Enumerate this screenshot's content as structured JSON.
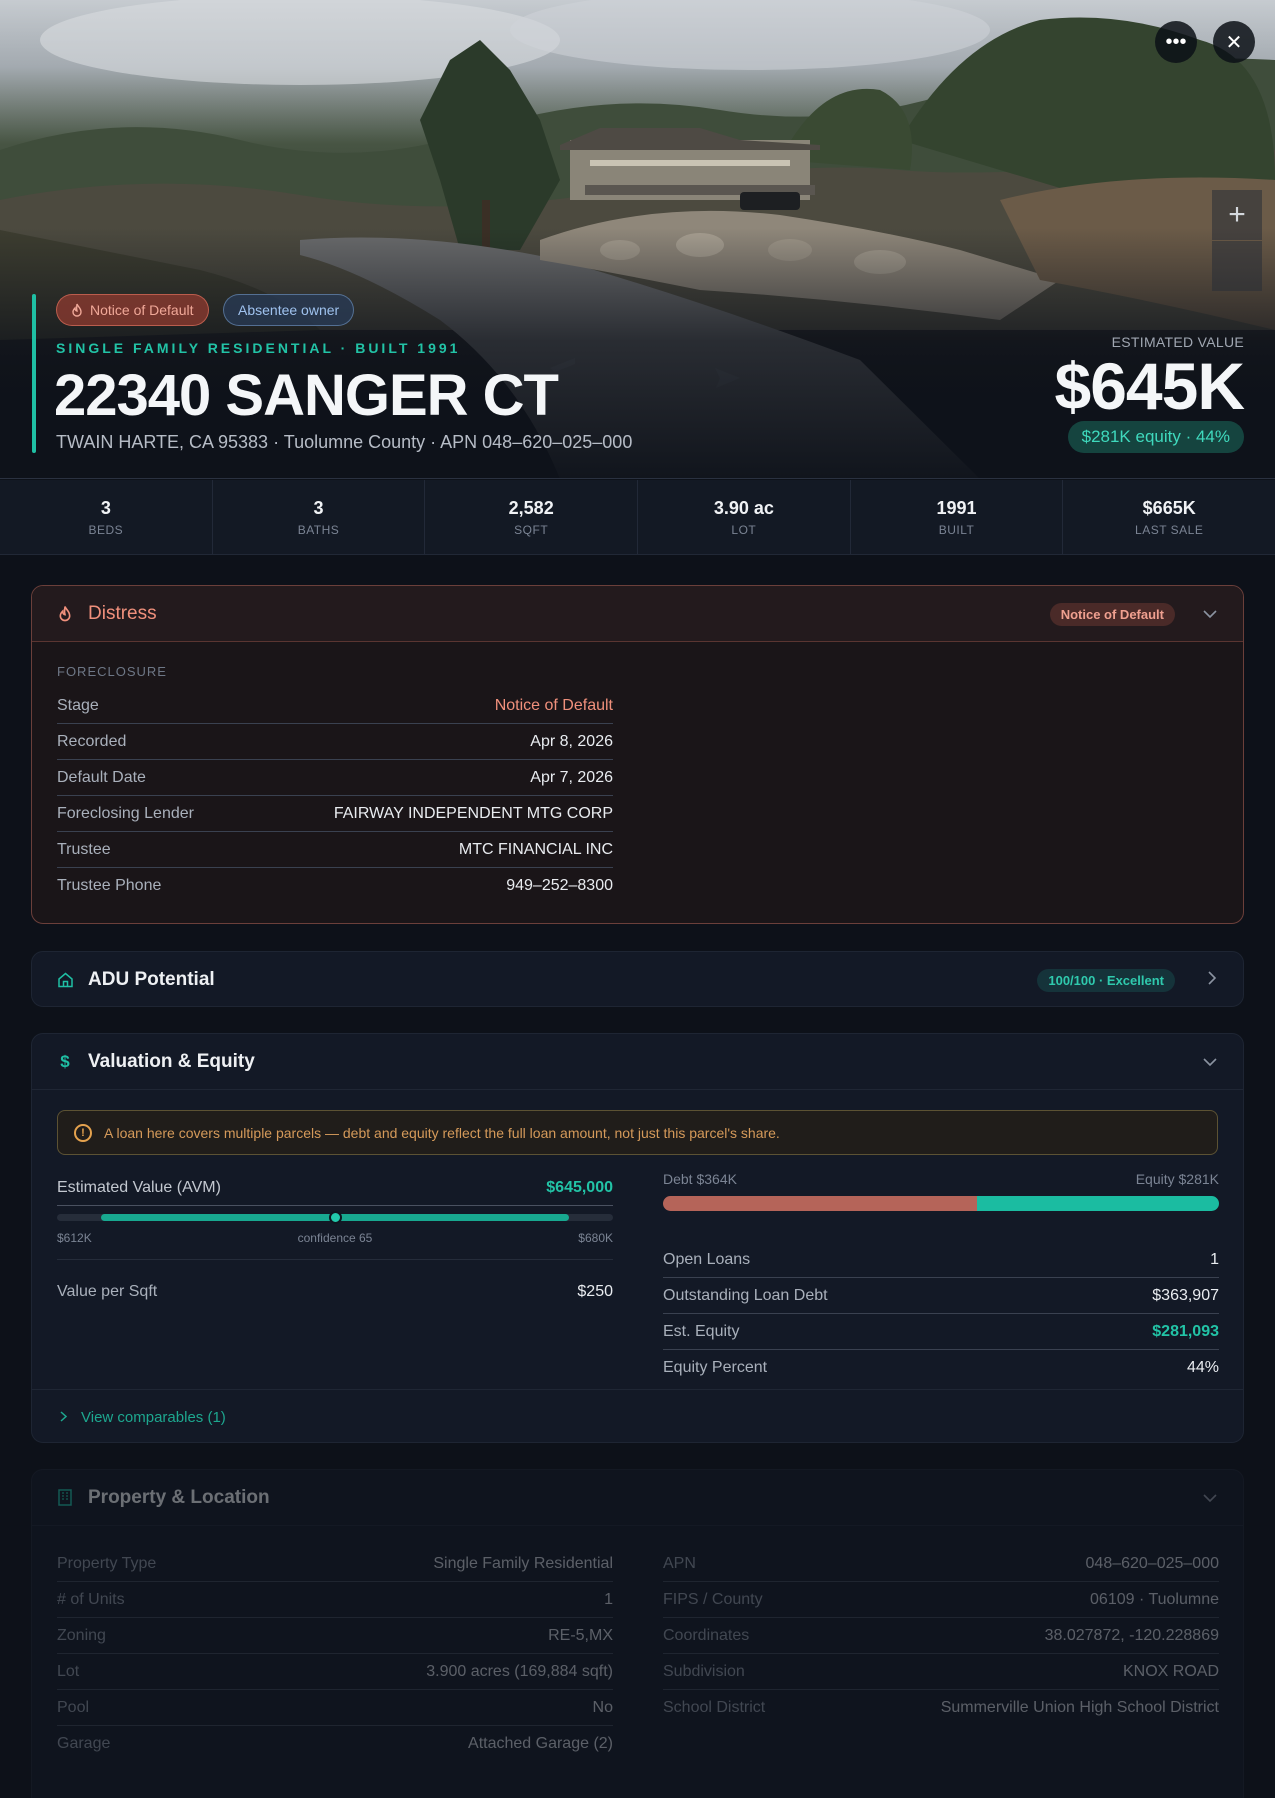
{
  "hero": {
    "tags": [
      "Notice of Default",
      "Absentee owner"
    ],
    "subtitle": "SINGLE FAMILY RESIDENTIAL · BUILT 1991",
    "address": "22340 SANGER CT",
    "address_line": "TWAIN HARTE, CA 95383 · Tuolumne County · APN 048–620–025–000",
    "estimated_value_label": "ESTIMATED VALUE",
    "estimated_value": "$645K",
    "equity_pill": "$281K equity · 44%",
    "icons": {
      "more": "more-horizontal-icon",
      "close": "close-icon",
      "zoom_in": "plus-icon",
      "flame": "flame-icon"
    }
  },
  "stats": [
    {
      "value": "3",
      "label": "BEDS"
    },
    {
      "value": "3",
      "label": "BATHS"
    },
    {
      "value": "2,582",
      "label": "SQFT"
    },
    {
      "value": "3.90 ac",
      "label": "LOT"
    },
    {
      "value": "1991",
      "label": "BUILT"
    },
    {
      "value": "$665K",
      "label": "LAST SALE"
    }
  ],
  "distress": {
    "title": "Distress",
    "badge": "Notice of Default",
    "section": "FORECLOSURE",
    "rows": [
      {
        "k": "Stage",
        "v": "Notice of Default"
      },
      {
        "k": "Recorded",
        "v": "Apr 8, 2026"
      },
      {
        "k": "Default Date",
        "v": "Apr 7, 2026"
      },
      {
        "k": "Foreclosing Lender",
        "v": "FAIRWAY INDEPENDENT MTG CORP"
      },
      {
        "k": "Trustee",
        "v": "MTC FINANCIAL INC"
      },
      {
        "k": "Trustee Phone",
        "v": "949–252–8300"
      }
    ],
    "accent_color": "#f0907c"
  },
  "adu": {
    "title": "ADU Potential",
    "badge": "100/100 · Excellent"
  },
  "valuation": {
    "title": "Valuation & Equity",
    "warning": "A loan here covers multiple parcels — debt and equity reflect the full loan amount, not just this parcel's share.",
    "avm_label": "Estimated Value (AVM)",
    "avm_value": "$645,000",
    "range_low": "$612K",
    "range_high": "$680K",
    "confidence": "confidence 65",
    "confidence_fraction": 0.5,
    "value_per_sqft_label": "Value per Sqft",
    "value_per_sqft": "$250",
    "debt_label": "Debt $364K",
    "equity_label": "Equity $281K",
    "debt_fraction": 0.564,
    "rows": [
      {
        "k": "Open Loans",
        "v": "1"
      },
      {
        "k": "Outstanding Loan Debt",
        "v": "$363,907"
      },
      {
        "k": "Est. Equity",
        "v": "$281,093"
      },
      {
        "k": "Equity Percent",
        "v": "44%"
      }
    ],
    "comparables": "View comparables (1)",
    "accent_color": "#22c3a6"
  },
  "property": {
    "title": "Property & Location",
    "left": [
      {
        "k": "Property Type",
        "v": "Single Family Residential"
      },
      {
        "k": "# of Units",
        "v": "1"
      },
      {
        "k": "Zoning",
        "v": "RE-5,MX"
      },
      {
        "k": "Lot",
        "v": "3.900 acres (169,884 sqft)"
      },
      {
        "k": "Pool",
        "v": "No"
      },
      {
        "k": "Garage",
        "v": "Attached Garage (2)"
      }
    ],
    "right": [
      {
        "k": "APN",
        "v": "048–620–025–000"
      },
      {
        "k": "FIPS / County",
        "v": "06109 · Tuolumne"
      },
      {
        "k": "Coordinates",
        "v": "38.027872, -120.228869"
      },
      {
        "k": "Subdivision",
        "v": "KNOX ROAD"
      },
      {
        "k": "School District",
        "v": "Summerville Union High School District"
      }
    ]
  }
}
